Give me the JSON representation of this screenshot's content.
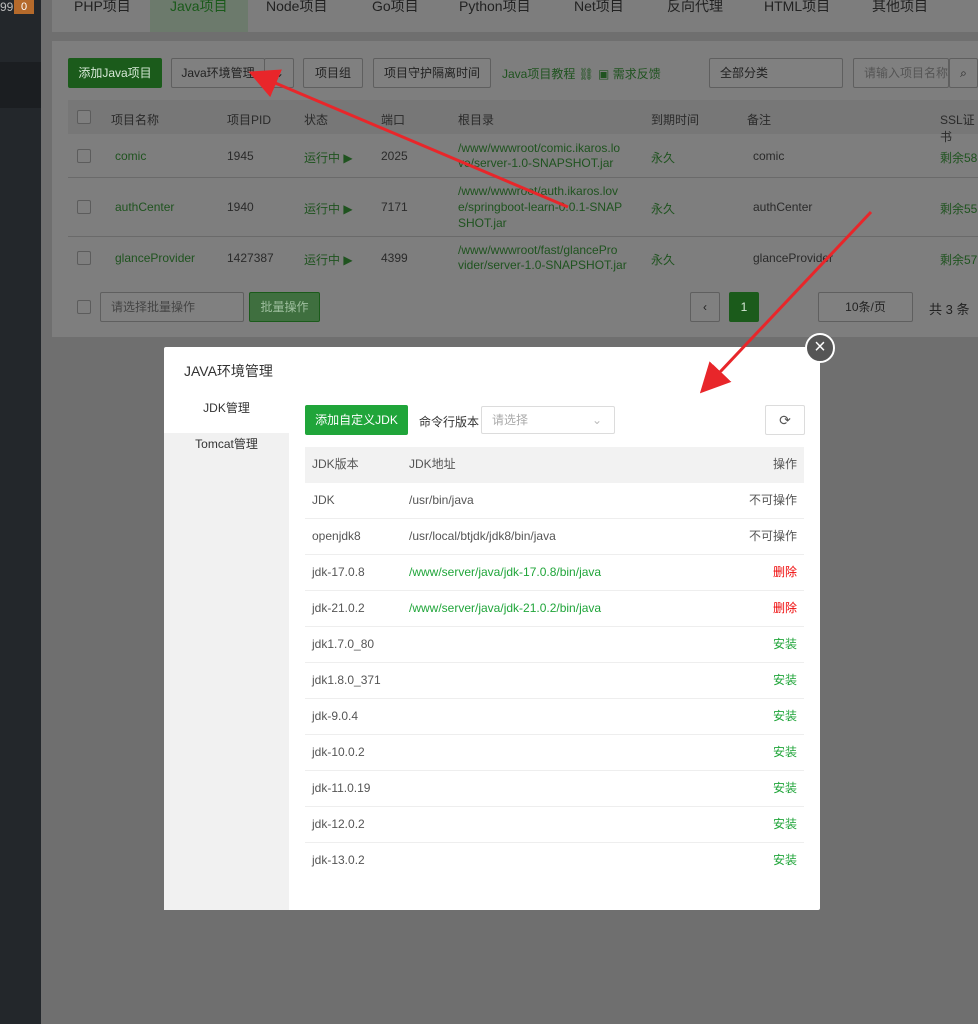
{
  "sidebar": {
    "num": "99",
    "badge": "0"
  },
  "tabs": [
    "PHP项目",
    "Java项目",
    "Node项目",
    "Go项目",
    "Python项目",
    "Net项目",
    "反向代理",
    "HTML项目",
    "其他项目"
  ],
  "toolbar": {
    "add_project": "添加Java项目",
    "env_manage": "Java环境管理",
    "project_group": "项目组",
    "guard_interval": "项目守护隔离时间",
    "tutorial": "Java项目教程",
    "feedback": "需求反馈",
    "category": "全部分类",
    "search_placeholder": "请输入项目名称"
  },
  "project_table": {
    "headers": [
      "项目名称",
      "项目PID",
      "状态",
      "端口",
      "根目录",
      "到期时间",
      "备注",
      "SSL证书"
    ],
    "rows": [
      {
        "name": "comic",
        "pid": "1945",
        "status": "运行中 ▶",
        "port": "2025",
        "root1": "/www/wwwroot/comic.ikaros.lo",
        "root2": "ve/server-1.0-SNAPSHOT.jar",
        "root3": "",
        "expire": "永久",
        "note": "comic",
        "ssl": "剩余58"
      },
      {
        "name": "authCenter",
        "pid": "1940",
        "status": "运行中 ▶",
        "port": "7171",
        "root1": "/www/wwwroot/auth.ikaros.lov",
        "root2": "e/springboot-learn-0.0.1-SNAP",
        "root3": "SHOT.jar",
        "expire": "永久",
        "note": "authCenter",
        "ssl": "剩余55"
      },
      {
        "name": "glanceProvider",
        "pid": "1427387",
        "status": "运行中 ▶",
        "port": "4399",
        "root1": "/www/wwwroot/fast/glancePro",
        "root2": "vider/server-1.0-SNAPSHOT.jar",
        "root3": "",
        "expire": "永久",
        "note": "glanceProvider",
        "ssl": "剩余57"
      }
    ]
  },
  "footer": {
    "batch_placeholder": "请选择批量操作",
    "batch_button": "批量操作",
    "page": "1",
    "page_size": "10条/页",
    "total": "共 3 条"
  },
  "modal": {
    "title": "JAVA环境管理",
    "left_menu": [
      "JDK管理",
      "Tomcat管理"
    ],
    "add_jdk": "添加自定义JDK",
    "cmd_label": "命令行版本",
    "cmd_placeholder": "请选择",
    "headers": {
      "version": "JDK版本",
      "path": "JDK地址",
      "op": "操作"
    },
    "rows": [
      {
        "version": "JDK",
        "path": "/usr/bin/java",
        "op": "不可操作",
        "kind": "none"
      },
      {
        "version": "openjdk8",
        "path": "/usr/local/btjdk/jdk8/bin/java",
        "op": "不可操作",
        "kind": "none"
      },
      {
        "version": "jdk-17.0.8",
        "path": "/www/server/java/jdk-17.0.8/bin/java",
        "op": "删除",
        "kind": "delete"
      },
      {
        "version": "jdk-21.0.2",
        "path": "/www/server/java/jdk-21.0.2/bin/java",
        "op": "删除",
        "kind": "delete"
      },
      {
        "version": "jdk1.7.0_80",
        "path": "",
        "op": "安装",
        "kind": "install"
      },
      {
        "version": "jdk1.8.0_371",
        "path": "",
        "op": "安装",
        "kind": "install"
      },
      {
        "version": "jdk-9.0.4",
        "path": "",
        "op": "安装",
        "kind": "install"
      },
      {
        "version": "jdk-10.0.2",
        "path": "",
        "op": "安装",
        "kind": "install"
      },
      {
        "version": "jdk-11.0.19",
        "path": "",
        "op": "安装",
        "kind": "install"
      },
      {
        "version": "jdk-12.0.2",
        "path": "",
        "op": "安装",
        "kind": "install"
      },
      {
        "version": "jdk-13.0.2",
        "path": "",
        "op": "安装",
        "kind": "install"
      }
    ]
  },
  "colors": {
    "accent_green": "#20a53a",
    "delete_red": "#ef0808",
    "arrow_red": "#e8262a"
  }
}
